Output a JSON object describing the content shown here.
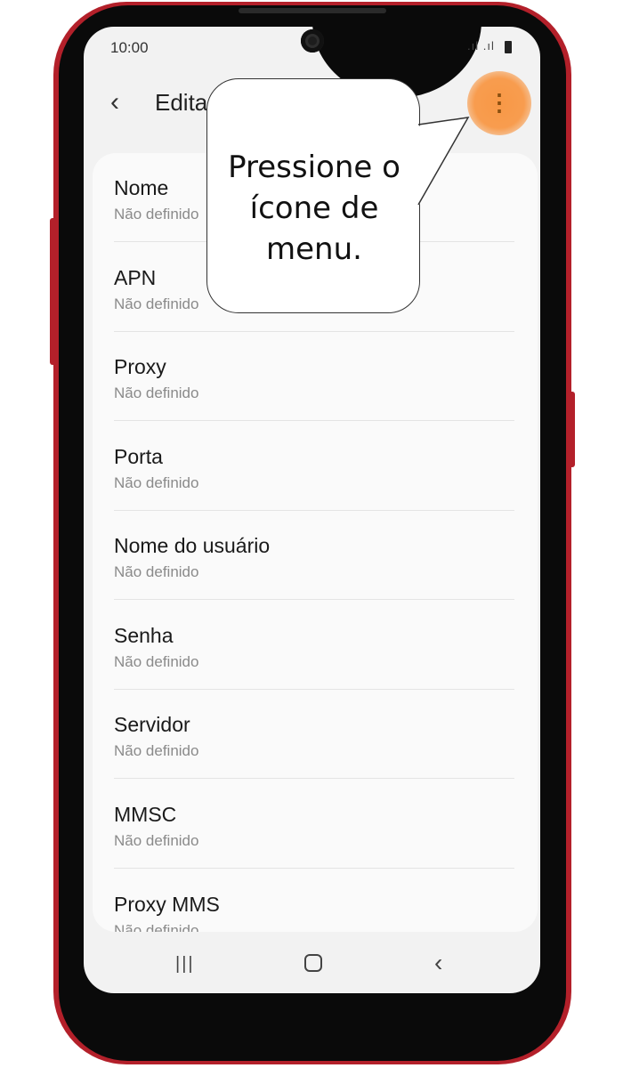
{
  "status_bar": {
    "time": "10:00",
    "signal": ".ıl .ıl"
  },
  "header": {
    "back_icon": "‹",
    "title": "Edita",
    "menu_icon": "⋮"
  },
  "list": {
    "items": [
      {
        "label": "Nome",
        "value": "Não definido"
      },
      {
        "label": "APN",
        "value": "Não definido"
      },
      {
        "label": "Proxy",
        "value": "Não definido"
      },
      {
        "label": "Porta",
        "value": "Não definido"
      },
      {
        "label": "Nome do usuário",
        "value": "Não definido"
      },
      {
        "label": "Senha",
        "value": "Não definido"
      },
      {
        "label": "Servidor",
        "value": "Não definido"
      },
      {
        "label": "MMSC",
        "value": "Não definido"
      },
      {
        "label": "Proxy MMS",
        "value": "Não definido"
      }
    ]
  },
  "nav_bar": {
    "recent_icon": "|||",
    "home_icon": "home-icon",
    "back_icon": "‹"
  },
  "callout": {
    "text": "Pressione o ícone de menu."
  },
  "colors": {
    "phone_frame": "#b3202a",
    "highlight": "#f89846"
  }
}
